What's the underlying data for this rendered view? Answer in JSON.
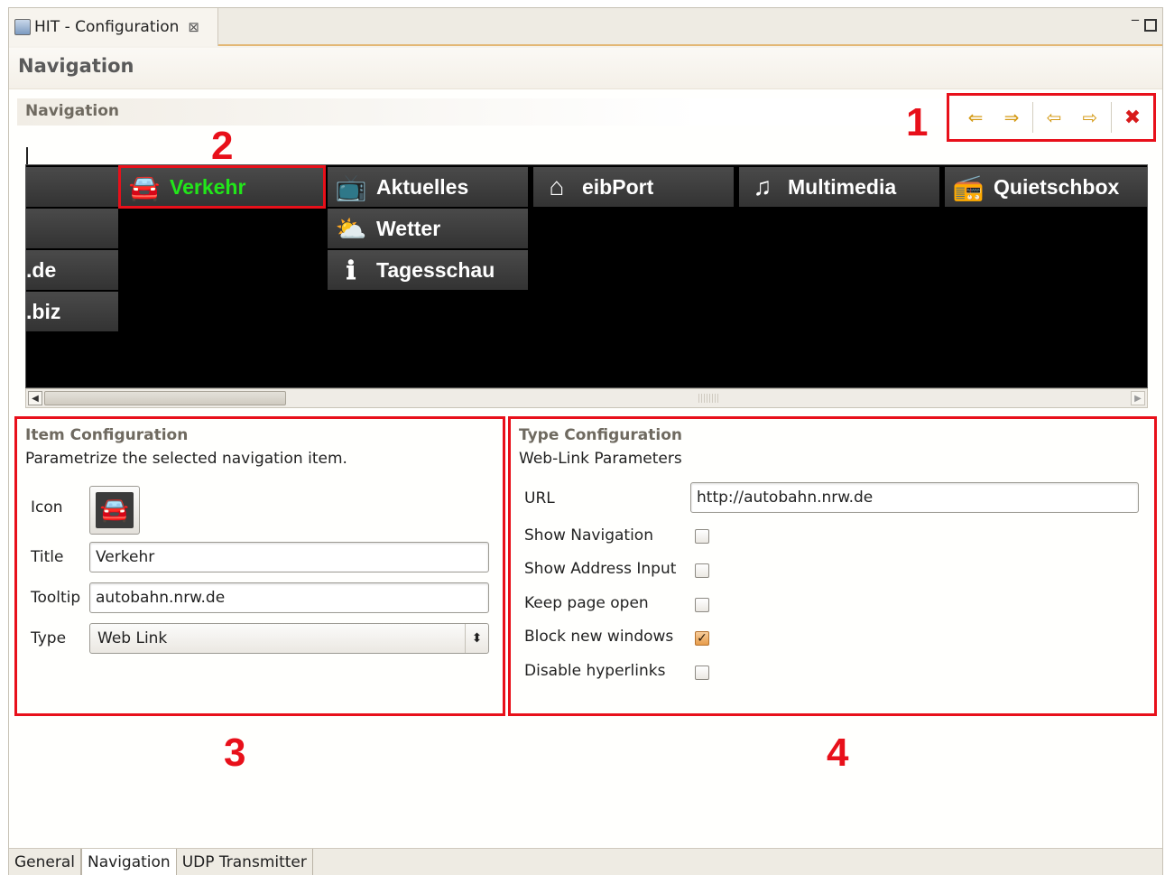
{
  "editor_tab": {
    "title": "HIT - Configuration",
    "close": "⊠"
  },
  "window_controls": {
    "minimize": "▭"
  },
  "form": {
    "title": "Navigation"
  },
  "navigation_section": {
    "title": "Navigation"
  },
  "toolbar": {
    "buttons": [
      {
        "name": "move-left-icon",
        "glyph": "⇐"
      },
      {
        "name": "move-right-icon",
        "glyph": "⇒"
      },
      {
        "name": "arrow-left-icon",
        "glyph": "⇦"
      },
      {
        "name": "arrow-right-icon",
        "glyph": "⇨"
      },
      {
        "name": "delete-icon",
        "glyph": "✖"
      }
    ]
  },
  "annotations": {
    "a1": "1",
    "a2": "2",
    "a3": "3",
    "a4": "4"
  },
  "nav_items": {
    "partial_blank": "",
    "verkehr": {
      "label": "Verkehr",
      "icon": "car-icon"
    },
    "aktuelles": {
      "label": "Aktuelles",
      "icon": "tv-icon"
    },
    "eibport": {
      "label": "eibPort",
      "icon": "home-icon"
    },
    "multimedia": {
      "label": "Multimedia",
      "icon": "music-icon"
    },
    "quietschbox": {
      "label": "Quietschbox",
      "icon": "radio-icon"
    },
    "wetter": {
      "label": "Wetter",
      "icon": "weather-icon"
    },
    "tagesschau": {
      "label": "Tagesschau",
      "icon": "info-icon"
    },
    "partial_de": ".de",
    "partial_biz": ".biz"
  },
  "item_config": {
    "title": "Item Configuration",
    "description": "Parametrize the selected navigation item.",
    "icon_label": "Icon",
    "title_label": "Title",
    "title_value": "Verkehr",
    "tooltip_label": "Tooltip",
    "tooltip_value": "autobahn.nrw.de",
    "type_label": "Type",
    "type_value": "Web Link"
  },
  "type_config": {
    "title": "Type Configuration",
    "description": "Web-Link Parameters",
    "url_label": "URL",
    "url_value": "http://autobahn.nrw.de",
    "options": [
      {
        "label": "Show Navigation",
        "checked": false
      },
      {
        "label": "Show Address Input",
        "checked": false
      },
      {
        "label": "Keep page open",
        "checked": false
      },
      {
        "label": "Block new windows",
        "checked": true
      },
      {
        "label": "Disable hyperlinks",
        "checked": false
      }
    ]
  },
  "bottom_tabs": [
    "General",
    "Navigation",
    "UDP Transmitter"
  ],
  "colors": {
    "annotation": "#e8101a",
    "selected_text": "#22e61a",
    "nav_background": "#000000"
  }
}
